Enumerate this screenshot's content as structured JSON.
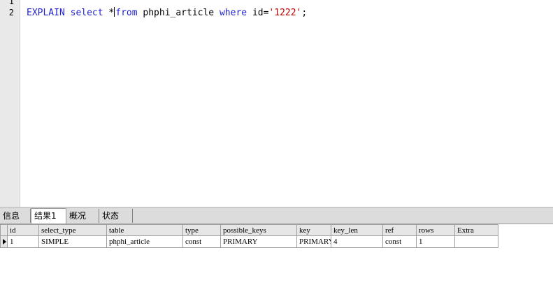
{
  "editor": {
    "line_numbers": [
      "1",
      "2"
    ],
    "line2": {
      "kw1": "EXPLAIN",
      "kw2": "select",
      "star": "*",
      "kw3": "from",
      "table": "phphi_article",
      "kw4": "where",
      "cond": "id=",
      "value": "'1222'",
      "semi": ";"
    },
    "colors": {
      "keyword": "#1f1fd1",
      "string": "#c00000"
    }
  },
  "tabs": [
    {
      "label": "信息"
    },
    {
      "label": "结果1",
      "active": true
    },
    {
      "label": "概况"
    },
    {
      "label": "状态"
    }
  ],
  "result": {
    "columns": [
      "id",
      "select_type",
      "table",
      "type",
      "possible_keys",
      "key",
      "key_len",
      "ref",
      "rows",
      "Extra"
    ],
    "rows": [
      [
        "1",
        "SIMPLE",
        "phphi_article",
        "const",
        "PRIMARY",
        "PRIMARY",
        "4",
        "const",
        "1",
        ""
      ]
    ]
  }
}
